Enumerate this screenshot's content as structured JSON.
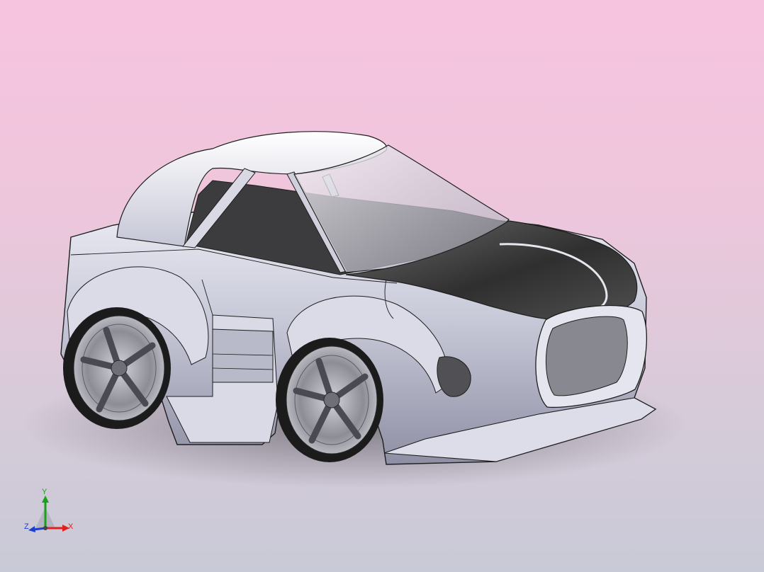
{
  "viewport": {
    "background_top": "#f7c4df",
    "background_bottom": "#c9cad7",
    "model": "stylized-car-model"
  },
  "colors": {
    "body": "#c9cad8",
    "hood": "#3a3a3a",
    "outline": "#1e1e1e",
    "tire": "#1b1b1b",
    "rim": "#8e8f96",
    "glass": "#ececf2"
  },
  "triad": {
    "x_label": "X",
    "y_label": "Y",
    "z_label": "Z",
    "x_color": "#e0201a",
    "y_color": "#1aa11a",
    "z_color": "#1d3fd0"
  }
}
